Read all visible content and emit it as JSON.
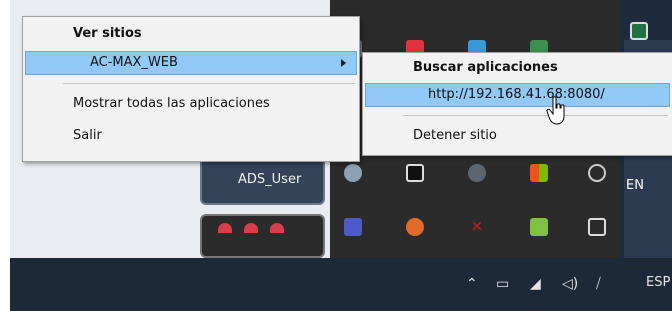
{
  "menu_main": {
    "header": "Ver sitios",
    "site_item": "AC-MAX_WEB",
    "show_all": "Mostrar todas las aplicaciones",
    "exit": "Salir"
  },
  "menu_sub": {
    "header": "Buscar aplicaciones",
    "url_item": "http://192.168.41.68:8080/",
    "stop_site": "Detener sitio"
  },
  "desktop": {
    "tile_label": "ADS_User",
    "right_label": "EN"
  },
  "taskbar": {
    "language": "ESP",
    "tray_glyphs": {
      "chevron": "^",
      "volume": "🔊"
    }
  },
  "colors": {
    "menu_bg": "#f2f2f2",
    "selected_bg": "#91c9f7",
    "taskbar_bg": "#1d2838",
    "overflow_bg": "#2b2b2b"
  },
  "icons": [
    "chevron-up-icon",
    "battery-icon",
    "wifi-icon",
    "volume-icon",
    "network-off-icon",
    "skype-icon",
    "microsoft-icon",
    "cloud-icon",
    "teams-icon",
    "printer-icon"
  ]
}
